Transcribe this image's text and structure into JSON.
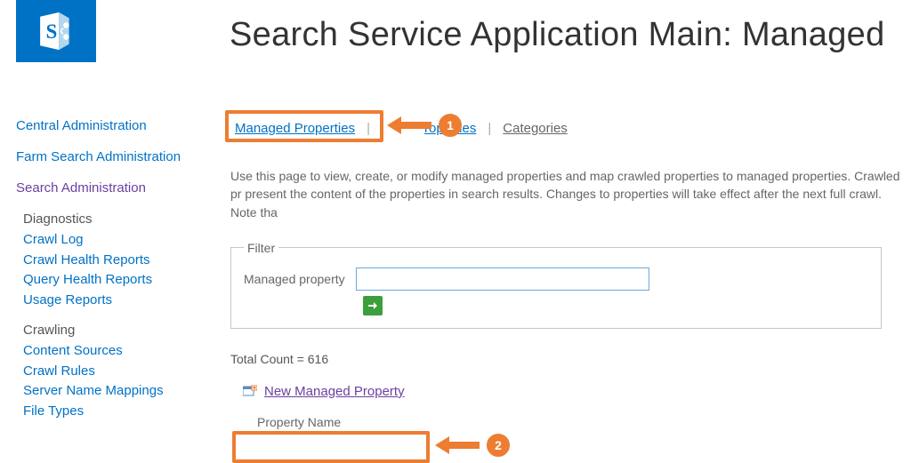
{
  "header": {
    "title": "Search Service Application Main: Managed "
  },
  "sidebar": {
    "top_links": [
      "Central Administration",
      "Farm Search Administration"
    ],
    "current": "Search Administration",
    "groups": [
      {
        "heading": "Diagnostics",
        "links": [
          "Crawl Log",
          "Crawl Health Reports",
          "Query Health Reports",
          "Usage Reports"
        ]
      },
      {
        "heading": "Crawling",
        "links": [
          "Content Sources",
          "Crawl Rules",
          "Server Name Mappings",
          "File Types"
        ]
      }
    ]
  },
  "tabs": {
    "managed": "Managed Properties",
    "crawled_partial": "roperties",
    "categories": "Categories"
  },
  "description": "Use this page to view, create, or modify managed properties and map crawled properties to managed properties. Crawled pr present the content of the properties in search results. Changes to properties will take effect after the next full crawl. Note tha",
  "filter": {
    "legend": "Filter",
    "label": "Managed property",
    "value": ""
  },
  "total_count_label": "Total Count = 616",
  "new_link": "New Managed Property",
  "column": {
    "name": "Property Name"
  },
  "callouts": {
    "one": "1",
    "two": "2"
  }
}
